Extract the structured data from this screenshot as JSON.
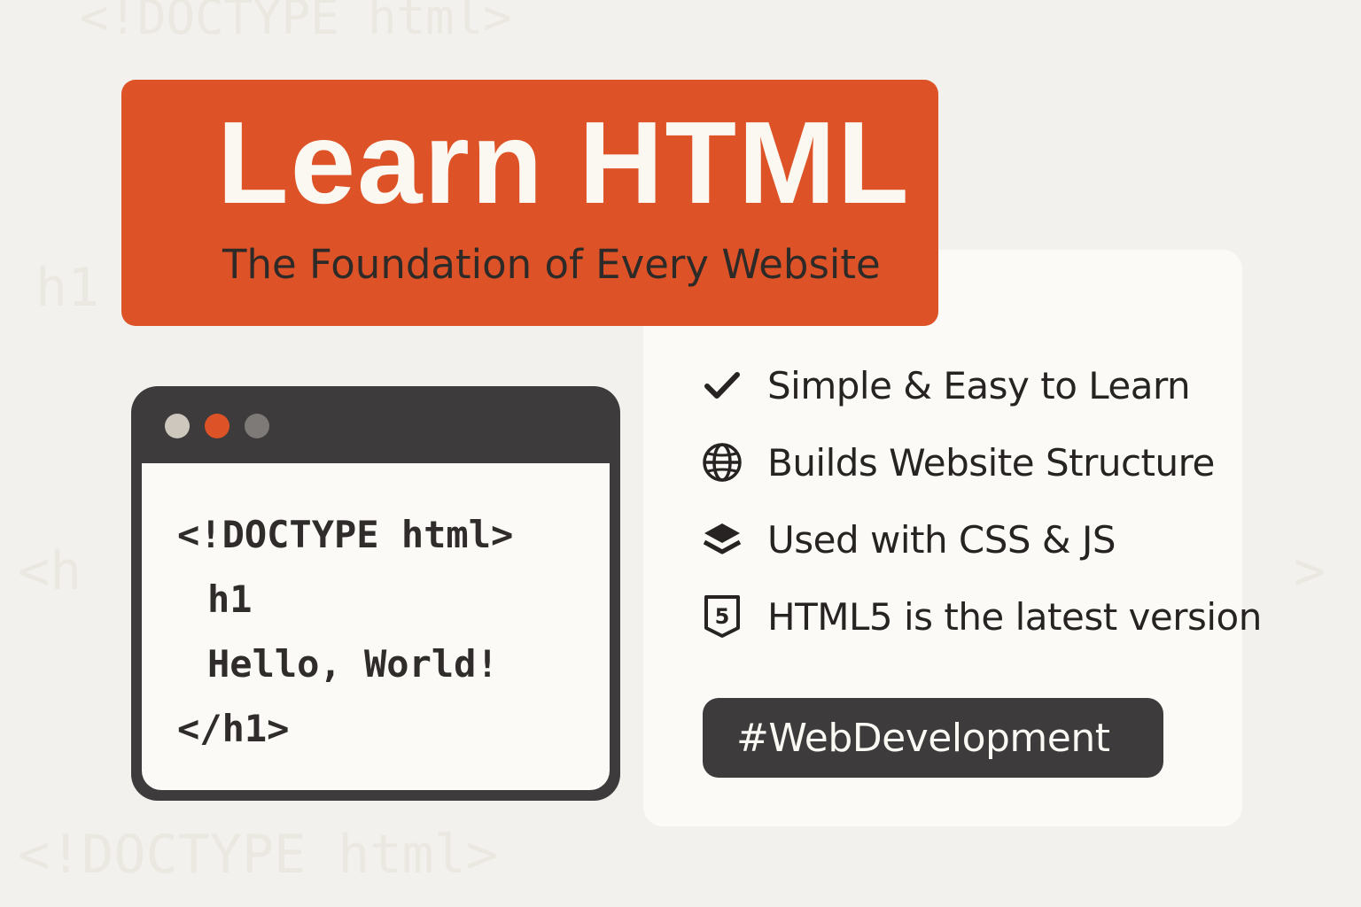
{
  "banner": {
    "title": "Learn HTML",
    "subtitle": "The Foundation of Every Website"
  },
  "code_window": {
    "traffic_lights": [
      "#cdc7bd",
      "#dd5327",
      "#7d7a78"
    ],
    "lines": [
      "<!DOCTYPE html>",
      "h1",
      "Hello, World!",
      "</h1>"
    ]
  },
  "features": [
    {
      "icon": "checkmark-icon",
      "label": "Simple & Easy to Learn"
    },
    {
      "icon": "globe-icon",
      "label": "Builds Website Structure"
    },
    {
      "icon": "layers-icon",
      "label": "Used with CSS & JS"
    },
    {
      "icon": "html5-icon",
      "label": "HTML5 is the latest version"
    }
  ],
  "hashtag": "#WebDevelopment",
  "colors": {
    "accent": "#dd5327",
    "dark": "#3d3b3b",
    "background": "#f3f1ed",
    "card": "#fbfaf6"
  }
}
